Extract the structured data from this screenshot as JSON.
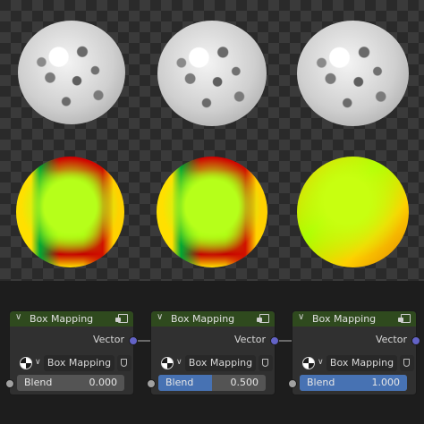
{
  "nodes": [
    {
      "title": "Box Mapping",
      "output_label": "Vector",
      "dropdown_value": "Box Mapping",
      "input_label": "Blend",
      "value_text": "0.000",
      "blend": 0.0
    },
    {
      "title": "Box Mapping",
      "output_label": "Vector",
      "dropdown_value": "Box Mapping",
      "input_label": "Blend",
      "value_text": "0.500",
      "blend": 0.5
    },
    {
      "title": "Box Mapping",
      "output_label": "Vector",
      "dropdown_value": "Box Mapping",
      "input_label": "Blend",
      "value_text": "1.000",
      "blend": 1.0
    }
  ],
  "colors": {
    "node_header": "#2f4a1e",
    "vector_socket": "#6363c7",
    "float_socket": "#a1a1a1",
    "slider_fill": "#4772b3"
  },
  "icons": [
    "chevron-down-icon",
    "node-preview-icon",
    "projection-sphere-icon",
    "fake-user-shield-icon"
  ]
}
